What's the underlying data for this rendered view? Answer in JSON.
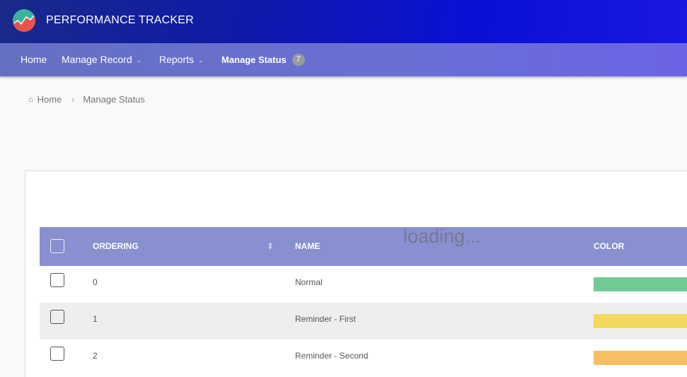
{
  "app": {
    "title": "PERFORMANCE TRACKER"
  },
  "nav": {
    "home": "Home",
    "manage_record": "Manage Record",
    "reports": "Reports",
    "manage_status": "Manage Status",
    "manage_status_count": "7"
  },
  "breadcrumb": {
    "home": "Home",
    "current": "Manage Status"
  },
  "overlay": {
    "loading": "loading..."
  },
  "table": {
    "headers": {
      "ordering": "ORDERING",
      "name": "NAME",
      "color": "COLOR"
    },
    "rows": [
      {
        "ordering": "0",
        "name": "Normal",
        "color": "#6fcb94"
      },
      {
        "ordering": "1",
        "name": "Reminder - First",
        "color": "#f5d860"
      },
      {
        "ordering": "2",
        "name": "Reminder - Second",
        "color": "#f7bf62"
      }
    ]
  },
  "icons": {
    "logo": "chart-logo-icon",
    "home": "home-icon",
    "sort": "sort-icon",
    "chevron": "chevron-down-icon"
  }
}
